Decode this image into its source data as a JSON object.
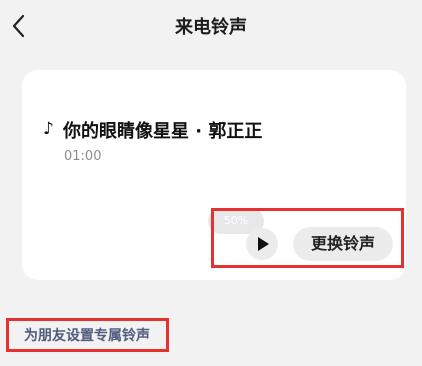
{
  "header": {
    "back_icon": "chevron-left-icon",
    "title": "来电铃声"
  },
  "ringtone_card": {
    "note_icon": "♪",
    "song_title": "你的眼睛像星星 · 郭正正",
    "duration": "01:00",
    "progress_chip": "50%",
    "play_icon": "play-icon",
    "change_button_label": "更换铃声"
  },
  "friend_link": {
    "label": "为朋友设置专属铃声"
  },
  "colors": {
    "background": "#f2f2f2",
    "card": "#ffffff",
    "highlight": "#e5312f",
    "link": "#4f5c7d",
    "button_bg": "#ececec"
  }
}
